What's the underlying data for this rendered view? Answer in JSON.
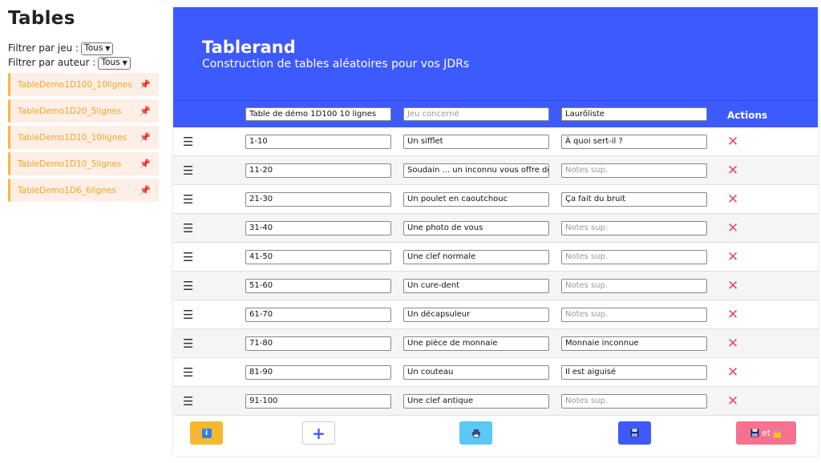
{
  "sidebar": {
    "title": "Tables",
    "filter_game_label": "Filtrer par jeu :",
    "filter_game_value": "Tous",
    "filter_author_label": "Filtrer par auteur :",
    "filter_author_value": "Tous",
    "tables": [
      {
        "name": "TableDemo1D100_10lignes"
      },
      {
        "name": "TableDemo1D20_5lignes"
      },
      {
        "name": "TableDemo1D10_10lignes"
      },
      {
        "name": "TableDemo1D10_5lignes"
      },
      {
        "name": "TableDemo1D6_6lignes"
      }
    ]
  },
  "header": {
    "title": "Tablerand",
    "subtitle": "Construction de tables aléatoires pour vos JDRs"
  },
  "table_head": {
    "name_value": "Table de démo 1D100 10 lignes",
    "game_placeholder": "Jeu concerné",
    "author_value": "Laurôliste",
    "actions_label": "Actions"
  },
  "rows": [
    {
      "range": "1-10",
      "result": "Un sifflet",
      "notes": "À quoi sert-il ?",
      "notes_placeholder": ""
    },
    {
      "range": "11-20",
      "result": "Soudain ... un inconnu vous offre des fle",
      "notes": "",
      "notes_placeholder": "Notes sup."
    },
    {
      "range": "21-30",
      "result": "Un poulet en caoutchouc",
      "notes": "Ça fait du bruit",
      "notes_placeholder": ""
    },
    {
      "range": "31-40",
      "result": "Une photo de vous",
      "notes": "",
      "notes_placeholder": "Notes sup."
    },
    {
      "range": "41-50",
      "result": "Une clef normale",
      "notes": "",
      "notes_placeholder": "Notes sup."
    },
    {
      "range": "51-60",
      "result": "Un cure-dent",
      "notes": "",
      "notes_placeholder": "Notes sup."
    },
    {
      "range": "61-70",
      "result": "Un décapsuleur",
      "notes": "",
      "notes_placeholder": "Notes sup."
    },
    {
      "range": "71-80",
      "result": "Une pièce de monnaie",
      "notes": "Monnaie inconnue",
      "notes_placeholder": ""
    },
    {
      "range": "81-90",
      "result": "Un couteau",
      "notes": "Il est aiguisé",
      "notes_placeholder": ""
    },
    {
      "range": "91-100",
      "result": "Une clef antique",
      "notes": "",
      "notes_placeholder": "Notes sup."
    }
  ],
  "footer": {
    "save_lock_label": "et"
  },
  "colors": {
    "primary": "#3d5afe",
    "sidebar_item_bg": "#fdeee6",
    "sidebar_item_text": "#f5a623",
    "delete": "#e84a6f"
  },
  "icons": {
    "row_handle": "drag-handle-icon",
    "row_delete": "close-icon",
    "sidebar_pin": "pin-icon",
    "footer": [
      "info-icon",
      "plus-icon",
      "print-icon",
      "save-icon",
      "save-icon",
      "lock-icon"
    ]
  }
}
